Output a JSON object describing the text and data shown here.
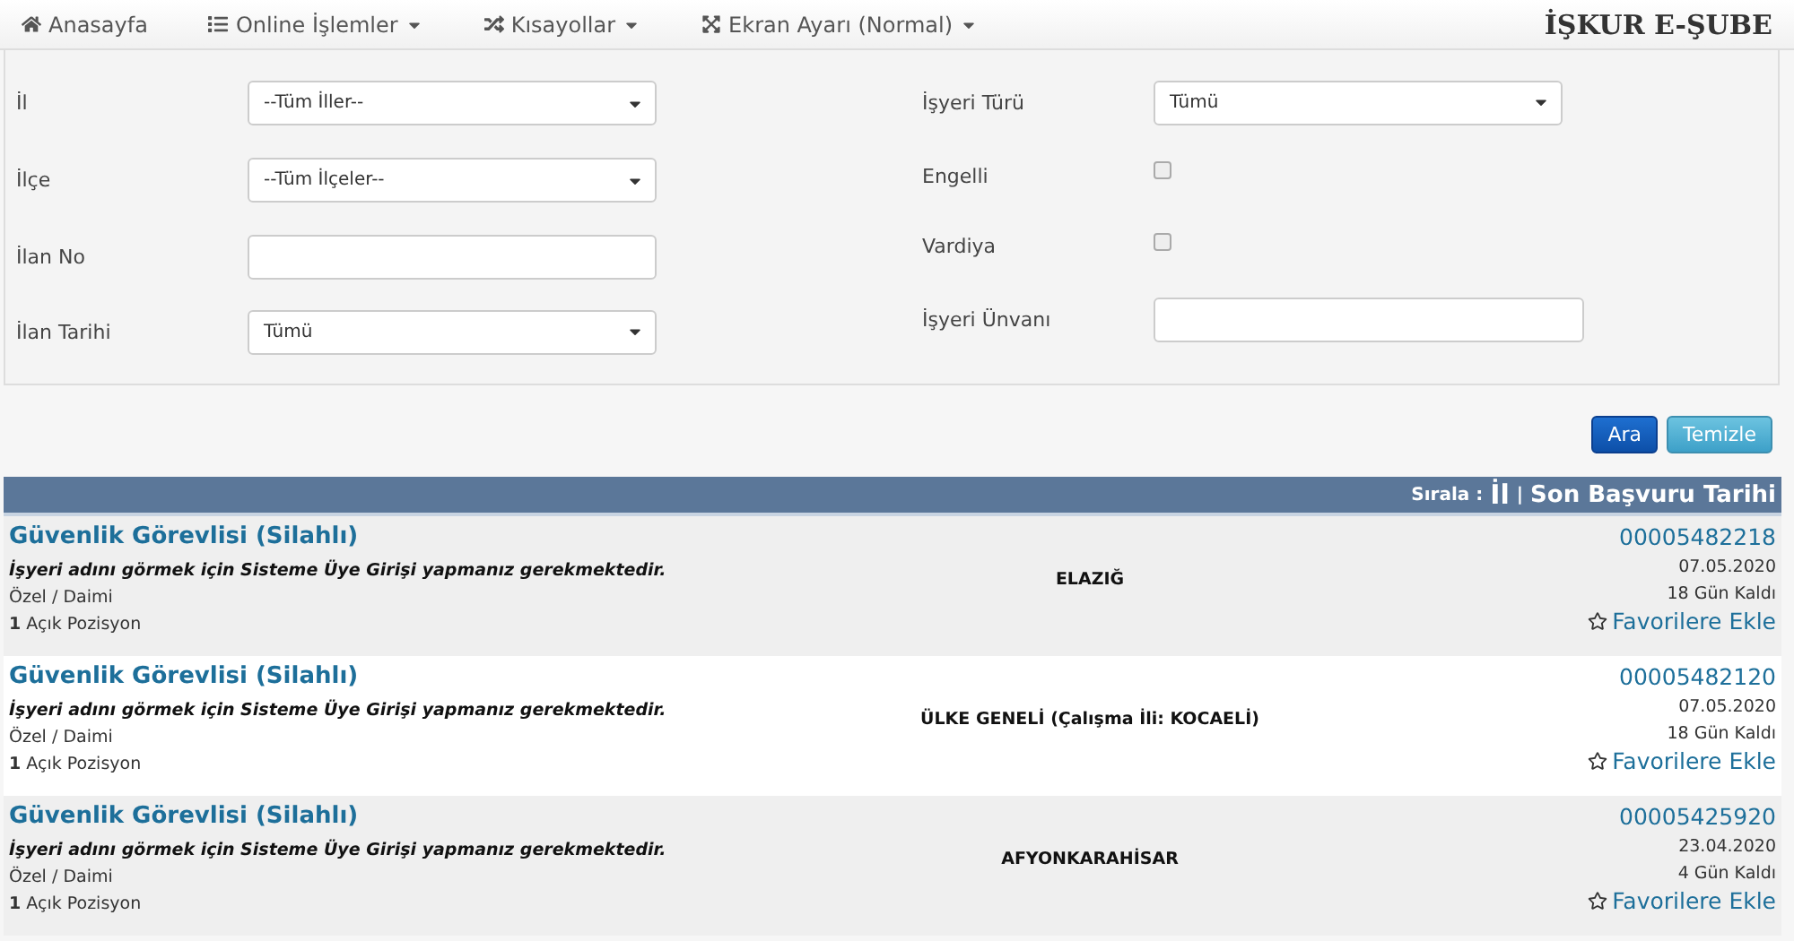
{
  "nav": {
    "items": [
      {
        "label": "Anasayfa",
        "caret": false
      },
      {
        "label": "Online İşlemler",
        "caret": true
      },
      {
        "label": "Kısayollar",
        "caret": true
      },
      {
        "label": "Ekran Ayarı (Normal)",
        "caret": true
      }
    ],
    "brand": "İŞKUR E-ŞUBE"
  },
  "filters": {
    "left": [
      {
        "label": "İl",
        "kind": "select",
        "value": "--Tüm İller--"
      },
      {
        "label": "İlçe",
        "kind": "select",
        "value": "--Tüm İlçeler--"
      },
      {
        "label": "İlan No",
        "kind": "text"
      },
      {
        "label": "İlan Tarihi",
        "kind": "select",
        "value": "Tümü"
      }
    ],
    "right": [
      {
        "label": "İşyeri Türü",
        "kind": "select",
        "value": "Tümü"
      },
      {
        "label": "Engelli",
        "kind": "checkbox",
        "checked": false
      },
      {
        "label": "Vardiya",
        "kind": "checkbox",
        "checked": false
      },
      {
        "label": "İşyeri Ünvanı",
        "kind": "text"
      }
    ]
  },
  "buttons": [
    {
      "label": "Ara",
      "kind": "primary"
    },
    {
      "label": "Temizle",
      "kind": "info"
    }
  ],
  "sort": {
    "label": "Sırala :",
    "options": [
      "İl",
      "Son Başvuru Tarihi"
    ],
    "separator": "|"
  },
  "listings": [
    {
      "title": "Güvenlik Görevlisi (Silahlı)",
      "notice": "İşyeri adını görmek için Sisteme Üye Girişi yapmanız gerekmektedir.",
      "type": "Özel / Daimi",
      "count": "1",
      "positions": "Açık Pozisyon",
      "location": "ELAZIĞ",
      "number": "00005482218",
      "date": "07.05.2020",
      "remaining": "18 Gün Kaldı",
      "favorite": "Favorilere Ekle"
    },
    {
      "title": "Güvenlik Görevlisi (Silahlı)",
      "notice": "İşyeri adını görmek için Sisteme Üye Girişi yapmanız gerekmektedir.",
      "type": "Özel / Daimi",
      "count": "1",
      "positions": "Açık Pozisyon",
      "location": "ÜLKE GENELİ (Çalışma İli: KOCAELİ)",
      "number": "00005482120",
      "date": "07.05.2020",
      "remaining": "18 Gün Kaldı",
      "favorite": "Favorilere Ekle"
    },
    {
      "title": "Güvenlik Görevlisi (Silahlı)",
      "notice": "İşyeri adını görmek için Sisteme Üye Girişi yapmanız gerekmektedir.",
      "type": "Özel / Daimi",
      "count": "1",
      "positions": "Açık Pozisyon",
      "location": "AFYONKARAHİSAR",
      "number": "00005425920",
      "date": "23.04.2020",
      "remaining": "4 Gün Kaldı",
      "favorite": "Favorilere Ekle"
    }
  ]
}
